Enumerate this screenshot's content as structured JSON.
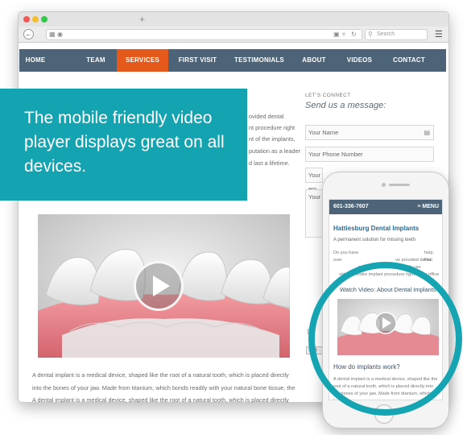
{
  "browser": {
    "new_tab": "+",
    "search_placeholder": "Search"
  },
  "nav": {
    "items": [
      "HOME",
      "TEAM",
      "SERVICES",
      "FIRST VISIT",
      "TESTIMONIALS",
      "ABOUT",
      "VIDEOS",
      "CONTACT"
    ],
    "active": "SERVICES",
    "bar_color": "#4d6478",
    "active_color": "#e55a1c"
  },
  "body": {
    "intro_lines": [
      "ovided dental",
      "nt procedure right",
      "nt of the implants,",
      "putation as a leader",
      "d last a lifetime."
    ],
    "article_lines": [
      "A dental implant is a medical device, shaped like the root of a natural tooth, which is placed directly",
      "into the bones of your jaw. Made from titanium, which bonds readily with your natural bone tissue, the",
      "A dental implant is a medical device, shaped like the root of a natural tooth, which is placed directly"
    ]
  },
  "contact": {
    "eyebrow": "LET'S CONNECT",
    "heading": "Send us a message:",
    "name_placeholder": "Your Name",
    "phone_placeholder": "Your Phone Number",
    "email_partial": "Your em",
    "message_partial": "Your",
    "submit_partial": "Sub"
  },
  "banner": {
    "text": "The mobile friendly video player displays great on all devices.",
    "color": "#13a3b1"
  },
  "mobile": {
    "phone_number": "601-336-7607",
    "menu_label": "≡ MENU",
    "title": "Hattiesburg Dental Implants",
    "subtitle": "A permanent solution for missing teeth",
    "para_lines": [
      "Do you have",
      "help. For",
      "over",
      "ve provided dental",
      "patients in Hattiesburg. We can",
      "vide the entire implant procedure right in our office"
    ],
    "video_title": "Watch Video: About Dental Implants",
    "heading2": "How do implants work?",
    "bottom_lines": [
      "A dental implant is a medical device, shaped like the",
      "root of a natural tooth, which is placed directly into",
      "the bones of your jaw. Made from titanium, which bonds"
    ],
    "ring_color": "#16a4b3"
  },
  "icons": [
    "back-icon",
    "calendar-icon",
    "globe-icon",
    "reader-icon",
    "dropdown-icon",
    "reload-icon",
    "search-icon",
    "menu-icon",
    "play-icon",
    "contact-card-icon"
  ]
}
